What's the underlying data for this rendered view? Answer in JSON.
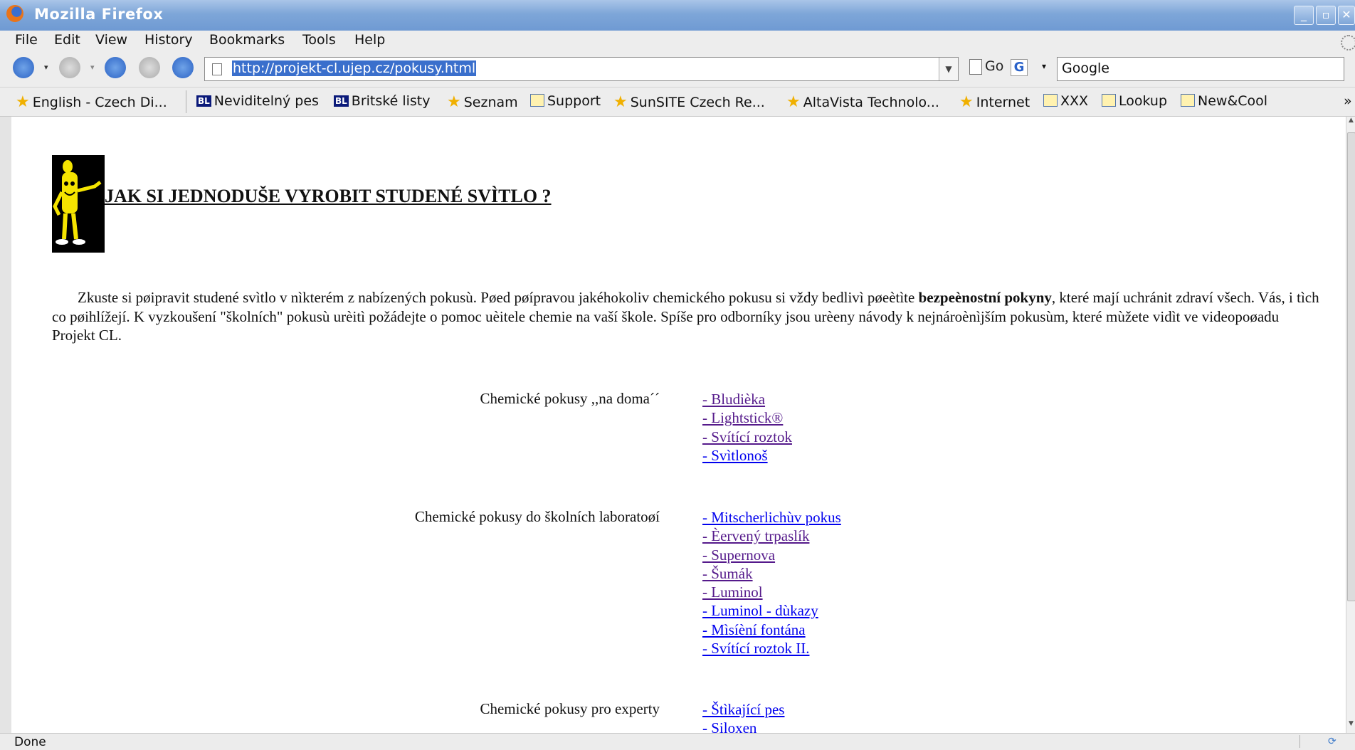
{
  "window": {
    "title": "Mozilla Firefox"
  },
  "menubar": [
    "File",
    "Edit",
    "View",
    "History",
    "Bookmarks",
    "Tools",
    "Help"
  ],
  "navbar": {
    "url": "http://projekt-cl.ujep.cz/pokusy.html",
    "go_label": "Go",
    "search_value": "Google"
  },
  "bookmarks": [
    {
      "label": "English - Czech Di...",
      "icon": "star-icon"
    },
    {
      "label": "Neviditelný pes",
      "icon": "bl-icon"
    },
    {
      "label": "Britské listy",
      "icon": "bl-icon"
    },
    {
      "label": "Seznam",
      "icon": "star-icon"
    },
    {
      "label": "Support",
      "icon": "livefeed-icon"
    },
    {
      "label": "SunSITE Czech Re...",
      "icon": "star-icon"
    },
    {
      "label": "AltaVista Technolo...",
      "icon": "star-icon"
    },
    {
      "label": "Internet",
      "icon": "star-icon"
    },
    {
      "label": "XXX",
      "icon": "livefeed-icon"
    },
    {
      "label": "Lookup",
      "icon": "livefeed-icon"
    },
    {
      "label": "New&Cool",
      "icon": "livefeed-icon"
    }
  ],
  "bookmarks_more": "»",
  "page": {
    "heading": "JAK SI JEDNODUŠE VYROBIT STUDENÉ SVÌTLO ?",
    "intro_before": "Zkuste si pøipravit studené svìtlo v nìkterém z nabízených pokusù. Pøed pøípravou jakéhokoliv chemického pokusu si vždy bedlivì pøeètìte ",
    "intro_bold": "bezpeènostní pokyny",
    "intro_after": ", které mají uchránit zdraví všech. Vás, i tìch co pøihlížejí. K vyzkoušení \"školních\" pokusù urèitì požádejte o pomoc uèitele chemie na vaší škole. Spíše pro odborníky jsou urèeny návody k nejnároènìjším pokusùm, které mùžete vidìt ve videopoøadu Projekt CL.",
    "sections": [
      {
        "category": "Chemické pokusy ,,na doma´´",
        "links": [
          {
            "text": "- Bludièka",
            "visited": true
          },
          {
            "text": "- Lightstick®",
            "visited": true
          },
          {
            "text": "- Svítící roztok",
            "visited": true
          },
          {
            "text": "- Svìtlonoš",
            "visited": false
          }
        ]
      },
      {
        "category": "Chemické pokusy do školních laboratoøí",
        "links": [
          {
            "text": "- Mitscherlichùv pokus",
            "visited": false
          },
          {
            "text": "- Èervený trpaslík",
            "visited": true
          },
          {
            "text": "- Supernova",
            "visited": true
          },
          {
            "text": "- Šumák",
            "visited": true
          },
          {
            "text": "- Luminol",
            "visited": true
          },
          {
            "text": "- Luminol - dùkazy",
            "visited": false
          },
          {
            "text": "- Mìsíèní fontána",
            "visited": false
          },
          {
            "text": "- Svítící roztok II.",
            "visited": false
          }
        ]
      },
      {
        "category": "Chemické pokusy pro experty",
        "links": [
          {
            "text": "- Štìkající pes",
            "visited": false
          },
          {
            "text": "- Siloxen",
            "visited": false
          }
        ]
      }
    ]
  },
  "statusbar": {
    "text": "Done"
  },
  "colors": {
    "link": "#0000ee",
    "visited": "#551a8b",
    "titlebar": "#7ea6d8"
  }
}
